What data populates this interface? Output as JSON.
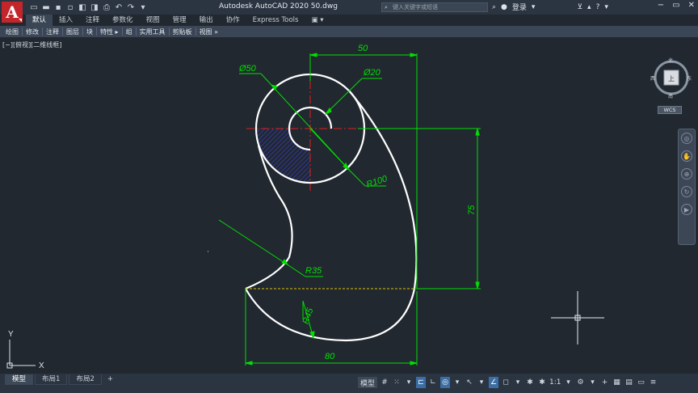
{
  "app": {
    "logo_letter": "A",
    "title": "Autodesk AutoCAD 2020    50.dwg",
    "search_placeholder": "键入关键字或短语",
    "login_label": "登录"
  },
  "ribbon_tabs": [
    {
      "label": "默认",
      "active": true
    },
    {
      "label": "插入",
      "active": false
    },
    {
      "label": "注释",
      "active": false
    },
    {
      "label": "参数化",
      "active": false
    },
    {
      "label": "视图",
      "active": false
    },
    {
      "label": "管理",
      "active": false
    },
    {
      "label": "输出",
      "active": false
    },
    {
      "label": "协作",
      "active": false
    },
    {
      "label": "Express Tools",
      "active": false
    }
  ],
  "ribbon_overflow": "▣ ▾",
  "panels": [
    "绘图",
    "修改",
    "注释",
    "图层",
    "块",
    "特性 ▸",
    "组",
    "实用工具",
    "剪贴板",
    "视图 »"
  ],
  "viewport_label": "[−][俯视][二维线框]",
  "dimensions": {
    "top_width": "50",
    "diameter_outer": "Ø50",
    "diameter_inner": "Ø20",
    "radius_100": "R100",
    "height_75": "75",
    "radius_35": "R35",
    "radius_45": "R45",
    "bottom_width": "80"
  },
  "viewcube": {
    "north": "北",
    "south": "南",
    "east": "东",
    "west": "西",
    "face": "上",
    "wcs": "WCS"
  },
  "ucs": {
    "x": "X",
    "y": "Y"
  },
  "layout_tabs": [
    {
      "label": "模型",
      "active": true
    },
    {
      "label": "布局1",
      "active": false
    },
    {
      "label": "布局2",
      "active": false
    }
  ],
  "layout_add": "+",
  "status": {
    "model": "模型",
    "scale": "1:1"
  },
  "colors": {
    "background": "#212830",
    "geometry": "#ffffff",
    "dimension": "#00e000",
    "centerline": "#e02020",
    "hatch": "#2b2fb0",
    "hidden": "#e0c000"
  }
}
